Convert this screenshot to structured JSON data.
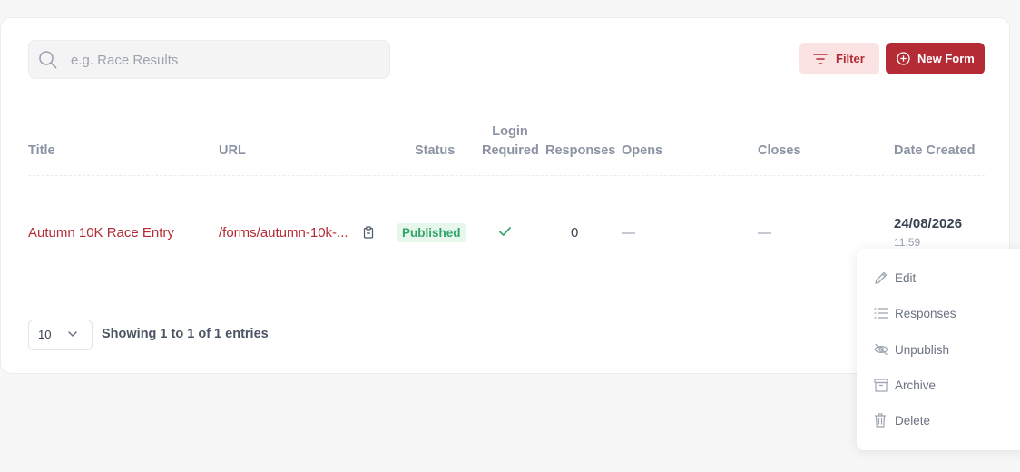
{
  "toolbar": {
    "search_placeholder": "e.g. Race Results",
    "filter_label": "Filter",
    "new_form_label": "New Form"
  },
  "table": {
    "headers": {
      "title": "Title",
      "url": "URL",
      "status": "Status",
      "login_line1": "Login",
      "login_line2": "Required",
      "responses": "Responses",
      "opens": "Opens",
      "closes": "Closes",
      "date_created": "Date Created"
    },
    "rows": [
      {
        "title": "Autumn 10K Race Entry",
        "url": "/forms/autumn-10k-...",
        "status": "Published",
        "login_required": true,
        "responses": "0",
        "opens": "—",
        "closes": "—",
        "date": "24/08/2026",
        "time": "11:59"
      }
    ]
  },
  "pagination": {
    "page_size": "10",
    "entries_text": "Showing 1 to 1 of 1 entries"
  },
  "action_menu": {
    "items": [
      {
        "label": "Edit",
        "icon": "pencil-icon"
      },
      {
        "label": "Responses",
        "icon": "list-icon"
      },
      {
        "label": "Unpublish",
        "icon": "eye-off-icon"
      },
      {
        "label": "Archive",
        "icon": "archive-icon"
      },
      {
        "label": "Delete",
        "icon": "trash-icon"
      }
    ]
  },
  "colors": {
    "accent": "#b42a35",
    "accent_light": "#fbe3e3",
    "success": "#30a46c",
    "success_bg": "#e7f7ec",
    "muted": "#8b93a3"
  }
}
